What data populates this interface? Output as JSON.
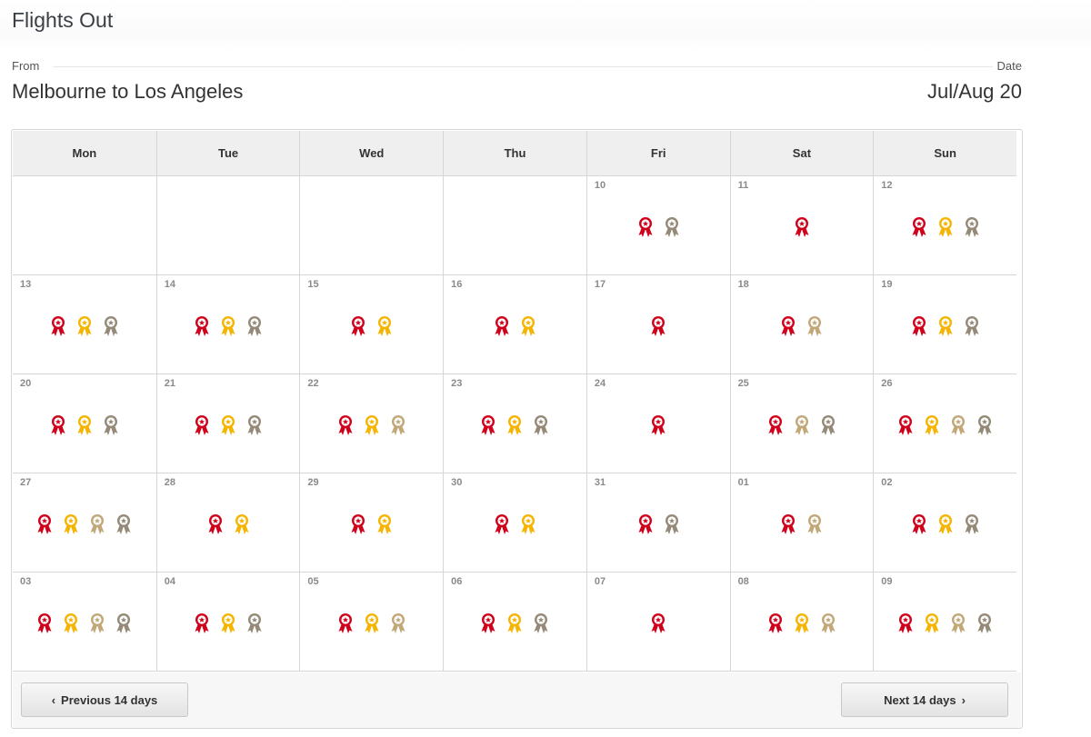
{
  "page": {
    "title": "Flights Out"
  },
  "summary": {
    "from_label": "From",
    "date_label": "Date",
    "route": "Melbourne to Los Angeles",
    "date_range": "Jul/Aug 20"
  },
  "calendar": {
    "weekdays": [
      "Mon",
      "Tue",
      "Wed",
      "Thu",
      "Fri",
      "Sat",
      "Sun"
    ],
    "award_colors": {
      "red": "#d0021b",
      "gold": "#f5b400",
      "tan": "#c2a878",
      "gray": "#958a78"
    },
    "days": [
      {
        "num": "",
        "awards": []
      },
      {
        "num": "",
        "awards": []
      },
      {
        "num": "",
        "awards": []
      },
      {
        "num": "",
        "awards": []
      },
      {
        "num": "10",
        "awards": [
          "red",
          "gray"
        ]
      },
      {
        "num": "11",
        "awards": [
          "red"
        ]
      },
      {
        "num": "12",
        "awards": [
          "red",
          "gold",
          "gray"
        ]
      },
      {
        "num": "13",
        "awards": [
          "red",
          "gold",
          "gray"
        ]
      },
      {
        "num": "14",
        "awards": [
          "red",
          "gold",
          "gray"
        ]
      },
      {
        "num": "15",
        "awards": [
          "red",
          "gold"
        ]
      },
      {
        "num": "16",
        "awards": [
          "red",
          "gold"
        ]
      },
      {
        "num": "17",
        "awards": [
          "red"
        ]
      },
      {
        "num": "18",
        "awards": [
          "red",
          "tan"
        ]
      },
      {
        "num": "19",
        "awards": [
          "red",
          "gold",
          "gray"
        ]
      },
      {
        "num": "20",
        "awards": [
          "red",
          "gold",
          "gray"
        ]
      },
      {
        "num": "21",
        "awards": [
          "red",
          "gold",
          "gray"
        ]
      },
      {
        "num": "22",
        "awards": [
          "red",
          "gold",
          "tan"
        ]
      },
      {
        "num": "23",
        "awards": [
          "red",
          "gold",
          "gray"
        ]
      },
      {
        "num": "24",
        "awards": [
          "red"
        ]
      },
      {
        "num": "25",
        "awards": [
          "red",
          "tan",
          "gray"
        ]
      },
      {
        "num": "26",
        "awards": [
          "red",
          "gold",
          "tan",
          "gray"
        ]
      },
      {
        "num": "27",
        "awards": [
          "red",
          "gold",
          "tan",
          "gray"
        ]
      },
      {
        "num": "28",
        "awards": [
          "red",
          "gold"
        ]
      },
      {
        "num": "29",
        "awards": [
          "red",
          "gold"
        ]
      },
      {
        "num": "30",
        "awards": [
          "red",
          "gold"
        ]
      },
      {
        "num": "31",
        "awards": [
          "red",
          "gray"
        ]
      },
      {
        "num": "01",
        "awards": [
          "red",
          "tan"
        ]
      },
      {
        "num": "02",
        "awards": [
          "red",
          "gold",
          "gray"
        ]
      },
      {
        "num": "03",
        "awards": [
          "red",
          "gold",
          "tan",
          "gray"
        ]
      },
      {
        "num": "04",
        "awards": [
          "red",
          "gold",
          "gray"
        ]
      },
      {
        "num": "05",
        "awards": [
          "red",
          "gold",
          "tan"
        ]
      },
      {
        "num": "06",
        "awards": [
          "red",
          "gold",
          "gray"
        ]
      },
      {
        "num": "07",
        "awards": [
          "red"
        ]
      },
      {
        "num": "08",
        "awards": [
          "red",
          "gold",
          "tan"
        ]
      },
      {
        "num": "09",
        "awards": [
          "red",
          "gold",
          "tan",
          "gray"
        ]
      }
    ]
  },
  "nav": {
    "prev_label": "Previous 14 days",
    "next_label": "Next 14 days",
    "prev_icon": "chevron-left-icon",
    "next_icon": "chevron-right-icon"
  }
}
